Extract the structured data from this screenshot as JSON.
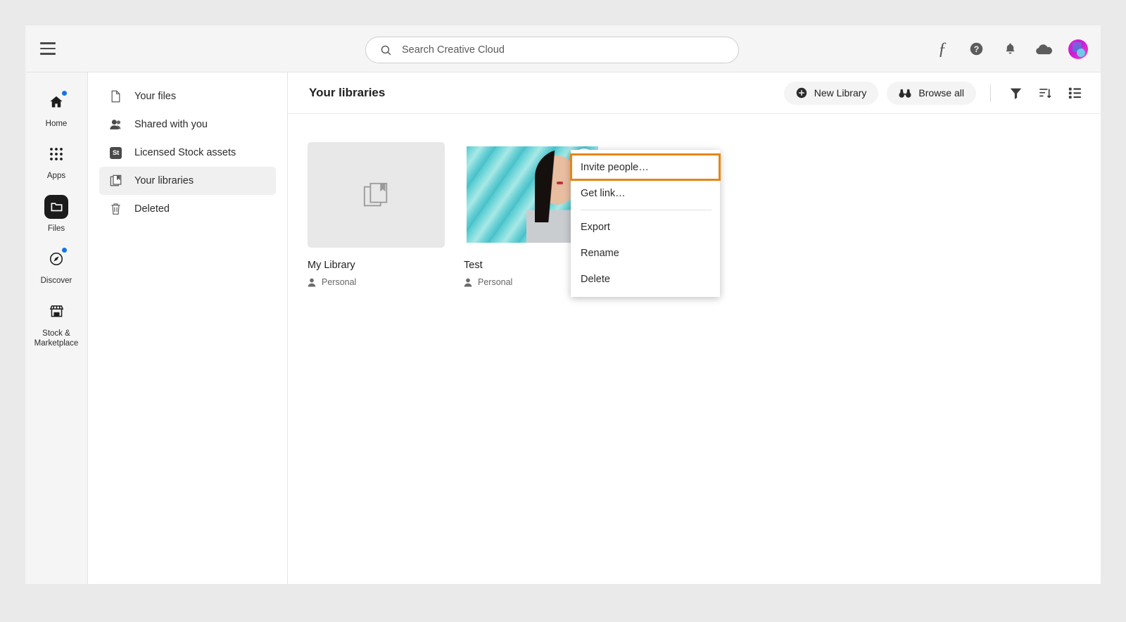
{
  "topbar": {
    "menu_label": "Main menu",
    "search": {
      "placeholder": "Search Creative Cloud",
      "value": ""
    },
    "icons": [
      {
        "name": "fonts-icon",
        "glyph": "f"
      },
      {
        "name": "help-icon",
        "glyph": "?"
      },
      {
        "name": "notifications-bell-icon",
        "glyph": "bell"
      },
      {
        "name": "cloud-sync-icon",
        "glyph": "cloud"
      },
      {
        "name": "user-avatar",
        "glyph": "avatar"
      }
    ]
  },
  "rail": {
    "items": [
      {
        "label": "Home",
        "icon": "home-icon",
        "active": false,
        "badge": true
      },
      {
        "label": "Apps",
        "icon": "apps-grid-icon",
        "active": false,
        "badge": false
      },
      {
        "label": "Files",
        "icon": "files-folder-icon",
        "active": true,
        "badge": false
      },
      {
        "label": "Discover",
        "icon": "discover-compass-icon",
        "active": false,
        "badge": true
      },
      {
        "label": "Stock & Marketplace",
        "icon": "storefront-icon",
        "active": false,
        "badge": false
      }
    ]
  },
  "subnav": {
    "items": [
      {
        "label": "Your files",
        "icon": "document-icon",
        "selected": false
      },
      {
        "label": "Shared with you",
        "icon": "people-icon",
        "selected": false
      },
      {
        "label": "Licensed Stock assets",
        "icon": "stock-badge-icon",
        "selected": false,
        "badge_text": "St"
      },
      {
        "label": "Your libraries",
        "icon": "library-icon",
        "selected": true
      },
      {
        "label": "Deleted",
        "icon": "trash-icon",
        "selected": false
      }
    ]
  },
  "main": {
    "title": "Your libraries",
    "actions": {
      "new_library": "New Library",
      "browse_all": "Browse all"
    },
    "tool_icons": [
      {
        "name": "filter-icon"
      },
      {
        "name": "sort-icon"
      },
      {
        "name": "list-view-icon"
      }
    ],
    "cards": [
      {
        "title": "My Library",
        "subtitle": "Personal",
        "thumb_type": "placeholder",
        "has_more_button": false
      },
      {
        "title": "Test",
        "subtitle": "Personal",
        "thumb_type": "photo",
        "has_more_button": true
      }
    ]
  },
  "context_menu": {
    "items": [
      {
        "label": "Invite people…",
        "highlighted": true,
        "divider_after": false
      },
      {
        "label": "Get link…",
        "highlighted": false,
        "divider_after": true
      },
      {
        "label": "Export",
        "highlighted": false,
        "divider_after": false
      },
      {
        "label": "Rename",
        "highlighted": false,
        "divider_after": false
      },
      {
        "label": "Delete",
        "highlighted": false,
        "divider_after": false
      }
    ]
  },
  "colors": {
    "highlight_border": "#e68619",
    "accent_blue": "#1473e6",
    "selected_bg": "#f0f0f0",
    "thumb_teal": "#54c9cf"
  }
}
